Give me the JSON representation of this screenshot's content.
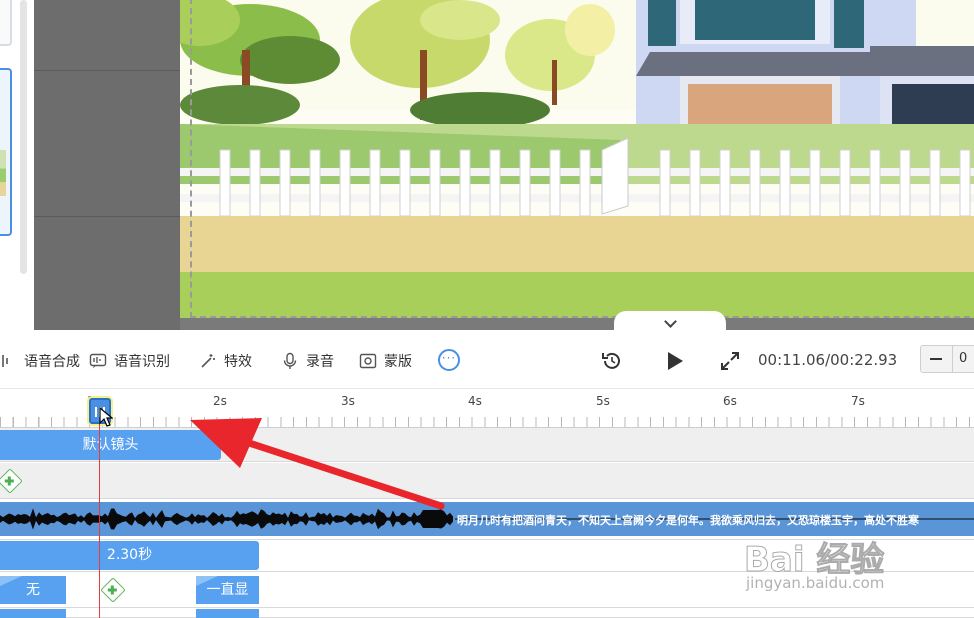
{
  "toolbar": {
    "tools": [
      {
        "label": "语音合成",
        "icon": "speech-synthesis-icon"
      },
      {
        "label": "语音识别",
        "icon": "speech-recognition-icon"
      },
      {
        "label": "特效",
        "icon": "effects-wand-icon"
      },
      {
        "label": "录音",
        "icon": "microphone-icon"
      },
      {
        "label": "蒙版",
        "icon": "mask-icon"
      }
    ],
    "more_icon": "more-dots-icon",
    "more_glyph": "···",
    "replay_icon": "replay-icon",
    "play_icon": "play-icon",
    "fullscreen_icon": "fullscreen-icon",
    "timecode": "00:11.06/00:22.93",
    "zoom_value": "0"
  },
  "ruler": {
    "labels": [
      "1",
      "2s",
      "3s",
      "4s",
      "5s",
      "6s",
      "7s"
    ]
  },
  "tracks": {
    "camera_clip_label": "默认镜头",
    "audio_lyric": "明月几时有把酒问青天，不知天上宫阙今夕是何年。我欲乘风归去，又恐琼楼玉宇，高处不胜寒",
    "duration_label": "2.30秒",
    "transition_in_label": "无",
    "transition_out_label": "一直显"
  },
  "watermark": {
    "brand": "Bai 经验",
    "site": "jingyan.baidu.com"
  },
  "colors": {
    "accent": "#4a90e2",
    "clip_blue": "#58a0f0",
    "playhead_red": "#e63b3b",
    "add_green": "#4caf50"
  }
}
